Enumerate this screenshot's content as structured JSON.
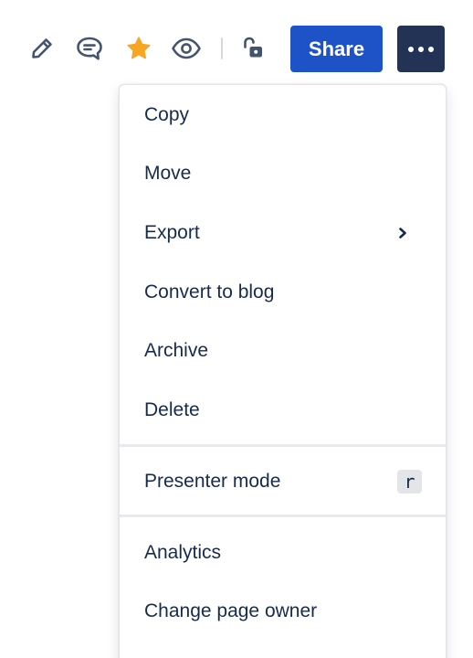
{
  "toolbar": {
    "icons": {
      "edit": "pencil-icon",
      "comment": "comment-icon",
      "star": "star-icon",
      "watch": "eye-icon",
      "restrictions": "unlock-icon",
      "more": "more-icon"
    },
    "share_label": "Share",
    "colors": {
      "icon": "#44546f",
      "star": "#f5a623",
      "share_bg": "#1e53c8",
      "more_bg": "#233355"
    }
  },
  "menu": {
    "items": [
      {
        "label": "Copy"
      },
      {
        "label": "Move"
      },
      {
        "label": "Export",
        "has_submenu": true
      },
      {
        "label": "Convert to blog"
      },
      {
        "label": "Archive"
      },
      {
        "label": "Delete"
      },
      {
        "label": "Presenter mode",
        "shortcut": "r"
      },
      {
        "label": "Analytics"
      },
      {
        "label": "Change page owner"
      }
    ]
  }
}
